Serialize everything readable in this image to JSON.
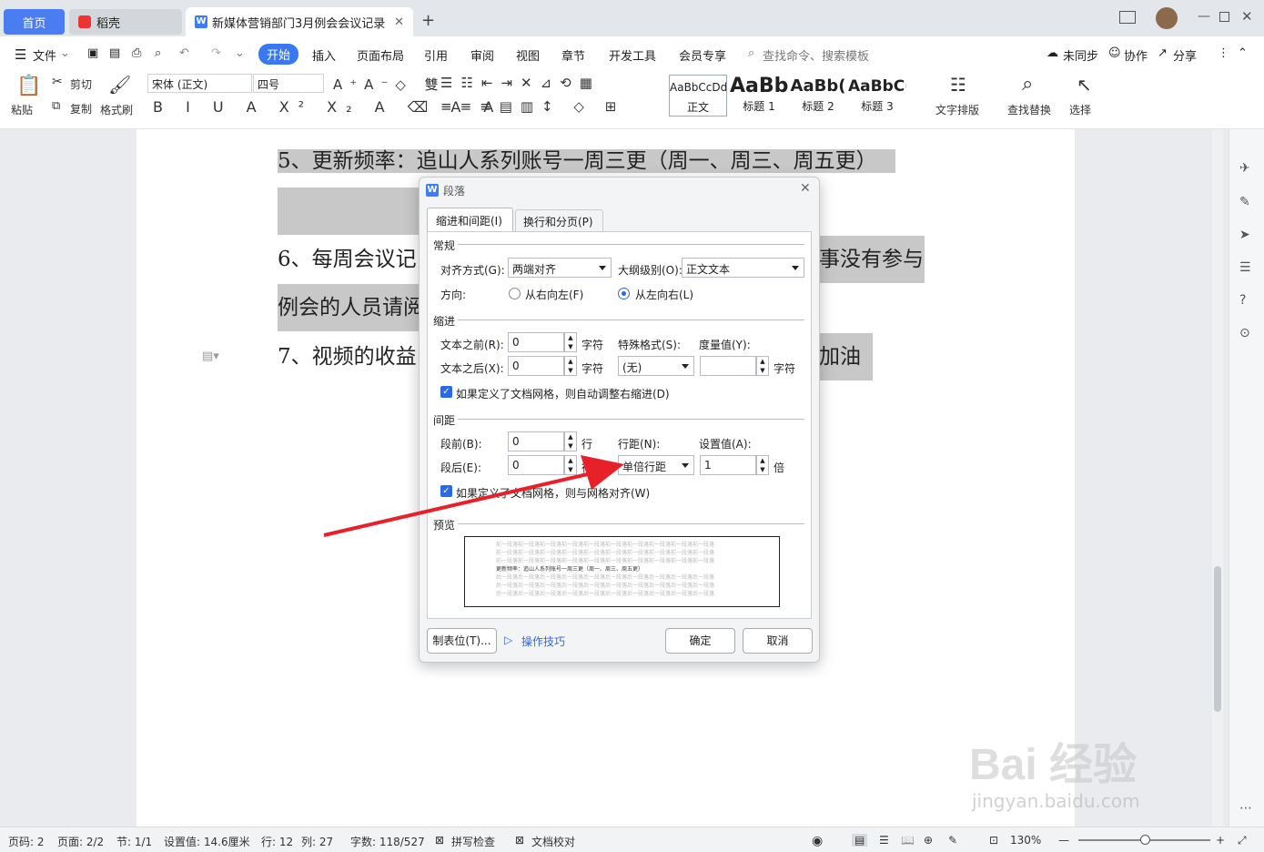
{
  "tabs": {
    "home": "首页",
    "daoke": "稻壳",
    "doc": "新媒体营销部门3月例会会议记录"
  },
  "menu": {
    "file": "文件",
    "start": "开始",
    "insert": "插入",
    "layout": "页面布局",
    "reference": "引用",
    "review": "审阅",
    "view": "视图",
    "chapter": "章节",
    "devtools": "开发工具",
    "member": "会员专享",
    "search": "查找命令、搜索模板",
    "unsync": "未同步",
    "collab": "协作",
    "share": "分享"
  },
  "toolbar": {
    "paste": "粘贴",
    "cut": "剪切",
    "copy": "复制",
    "format_painter": "格式刷",
    "font": "宋体 (正文)",
    "size": "四号",
    "text_layout": "文字排版",
    "find_replace": "查找替换",
    "select": "选择"
  },
  "styles": [
    {
      "sample": "AaBbCcDd",
      "label": "正文"
    },
    {
      "sample": "AaBb",
      "label": "标题 1"
    },
    {
      "sample": "AaBb(",
      "label": "标题 2"
    },
    {
      "sample": "AaBbC(",
      "label": "标题 3"
    }
  ],
  "document": {
    "line5": "5、更新频率：追山人系列账号一周三更（周一、周三、周五更）",
    "line6a": "6、每周会议记",
    "line6b": "事没有参与",
    "line6c": "例会的人员请阅",
    "line7a": "7、视频的收益",
    "line7b": "加油"
  },
  "dialog": {
    "title": "段落",
    "tab1": "缩进和间距(I)",
    "tab2": "换行和分页(P)",
    "general": "常规",
    "align_label": "对齐方式(G):",
    "align_value": "两端对齐",
    "outline_label": "大纲级别(O):",
    "outline_value": "正文文本",
    "direction_label": "方向:",
    "rtl": "从右向左(F)",
    "ltr": "从左向右(L)",
    "indent": "缩进",
    "before_text": "文本之前(R):",
    "before_text_val": "0",
    "after_text": "文本之后(X):",
    "after_text_val": "0",
    "unit_char": "字符",
    "special": "特殊格式(S):",
    "special_val": "(无)",
    "measure": "度量值(Y):",
    "grid_indent": "如果定义了文档网格，则自动调整右缩进(D)",
    "spacing": "间距",
    "space_before": "段前(B):",
    "space_before_val": "0",
    "space_after": "段后(E):",
    "space_after_val": "0",
    "unit_line": "行",
    "line_spacing": "行距(N):",
    "line_spacing_val": "单倍行距",
    "set_value": "设置值(A):",
    "set_value_val": "1",
    "unit_times": "倍",
    "grid_align": "如果定义了文档网格，则与网格对齐(W)",
    "preview": "预览",
    "preview_text": "更新频率：追山人系列账号一周三更（周一、周三、周五更）",
    "preview_filler": "前一段落前一段落前一段落前一段落前一段落前一段落前一段落前一段落前一段落前一段落",
    "preview_after": "后一段落后一段落后一段落后一段落后一段落后一段落后一段落后一段落后一段落后一段落",
    "tabs_btn": "制表位(T)...",
    "tips": "操作技巧",
    "ok": "确定",
    "cancel": "取消"
  },
  "status": {
    "page": "页码: 2",
    "pages": "页面: 2/2",
    "section": "节: 1/1",
    "setting": "设置值: 14.6厘米",
    "row": "行: 12",
    "col": "列: 27",
    "words": "字数: 118/527",
    "spell": "拼写检查",
    "proof": "文档校对",
    "zoom": "130%"
  },
  "watermark": "jingyan.baidu.com",
  "colors": {
    "accent": "#3a78f2",
    "arrow": "#e8202a"
  }
}
